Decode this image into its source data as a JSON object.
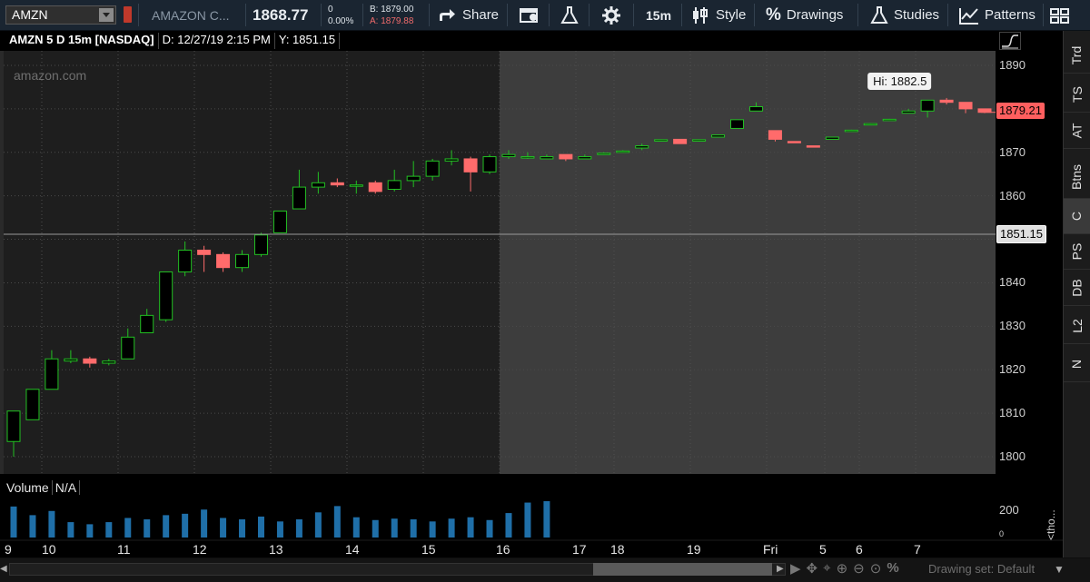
{
  "toolbar": {
    "symbol": "AMZN",
    "company": "AMAZON C...",
    "last_price": "1868.77",
    "change": "0",
    "change_pct": "0.00%",
    "bid": "B: 1879.00",
    "ask": "A: 1879.88",
    "share_label": "Share",
    "period_label": "15m",
    "style_label": "Style",
    "drawings_label": "Drawings",
    "studies_label": "Studies",
    "patterns_label": "Patterns"
  },
  "chart_header": {
    "title": "AMZN 5 D 15m [NASDAQ]",
    "date": "D: 12/27/19 2:15 PM",
    "y": "Y: 1851.15"
  },
  "watermark": "amazon.com",
  "price_axis": {
    "ticks": [
      "1890",
      "1880",
      "1870",
      "1860",
      "1850",
      "1840",
      "1830",
      "1820",
      "1810",
      "1800"
    ],
    "last_tag": "1879.21",
    "cursor_tag": "1851.15",
    "hi_label": "Hi: 1882.5"
  },
  "volume": {
    "label": "Volume",
    "value": "N/A",
    "axis_tick": "200",
    "axis_zero": "0",
    "axis_side": "<tho..."
  },
  "time_axis": [
    "9",
    "10",
    "11",
    "12",
    "13",
    "14",
    "15",
    "16",
    "17",
    "18",
    "19",
    "Fri",
    "5",
    "6",
    "7"
  ],
  "right_nav": [
    "Trd",
    "TS",
    "AT",
    "Btns",
    "C",
    "PS",
    "DB",
    "L2",
    "N"
  ],
  "bottom": {
    "drawing_set": "Drawing set: Default"
  },
  "colors": {
    "up": "#19b519",
    "down": "#ff6b6b",
    "toolbar": "#1a2531",
    "accent": "#e14c4c"
  },
  "chart_data": {
    "type": "candlestick",
    "title": "AMZN 5 D 15m [NASDAQ]",
    "ylim": [
      1797,
      1894
    ],
    "candles": [
      {
        "o": 1803.5,
        "h": 1810.5,
        "l": 1800.0,
        "c": 1810.5,
        "x": "9"
      },
      {
        "o": 1808.5,
        "h": 1815.5,
        "l": 1808.5,
        "c": 1815.5,
        "x": ""
      },
      {
        "o": 1815.5,
        "h": 1824.5,
        "l": 1815.5,
        "c": 1822.5,
        "x": "10"
      },
      {
        "o": 1822.0,
        "h": 1824.5,
        "l": 1821.5,
        "c": 1822.5,
        "x": ""
      },
      {
        "o": 1822.5,
        "h": 1823.0,
        "l": 1820.5,
        "c": 1821.5,
        "x": ""
      },
      {
        "o": 1821.5,
        "h": 1822.5,
        "l": 1821.0,
        "c": 1822.0,
        "x": ""
      },
      {
        "o": 1822.5,
        "h": 1829.5,
        "l": 1822.5,
        "c": 1827.5,
        "x": "11"
      },
      {
        "o": 1828.5,
        "h": 1834.0,
        "l": 1828.5,
        "c": 1832.5,
        "x": ""
      },
      {
        "o": 1831.5,
        "h": 1842.5,
        "l": 1831.0,
        "c": 1842.5,
        "x": ""
      },
      {
        "o": 1842.5,
        "h": 1849.5,
        "l": 1841.5,
        "c": 1847.5,
        "x": ""
      },
      {
        "o": 1847.5,
        "h": 1848.5,
        "l": 1842.5,
        "c": 1846.5,
        "x": "12"
      },
      {
        "o": 1846.5,
        "h": 1847.0,
        "l": 1842.5,
        "c": 1843.5,
        "x": ""
      },
      {
        "o": 1843.5,
        "h": 1847.5,
        "l": 1842.5,
        "c": 1846.5,
        "x": ""
      },
      {
        "o": 1846.5,
        "h": 1851.5,
        "l": 1846.0,
        "c": 1851.0,
        "x": "13"
      },
      {
        "o": 1851.5,
        "h": 1856.5,
        "l": 1851.5,
        "c": 1856.5,
        "x": ""
      },
      {
        "o": 1857.0,
        "h": 1866.0,
        "l": 1857.0,
        "c": 1862.0,
        "x": ""
      },
      {
        "o": 1862.0,
        "h": 1865.5,
        "l": 1860.5,
        "c": 1863.0,
        "x": ""
      },
      {
        "o": 1863.0,
        "h": 1864.0,
        "l": 1862.0,
        "c": 1862.5,
        "x": "14"
      },
      {
        "o": 1862.5,
        "h": 1863.5,
        "l": 1860.5,
        "c": 1862.5,
        "x": ""
      },
      {
        "o": 1863.0,
        "h": 1863.5,
        "l": 1860.5,
        "c": 1861.0,
        "x": ""
      },
      {
        "o": 1861.5,
        "h": 1866.0,
        "l": 1861.0,
        "c": 1863.5,
        "x": ""
      },
      {
        "o": 1863.5,
        "h": 1868.0,
        "l": 1862.0,
        "c": 1864.5,
        "x": ""
      },
      {
        "o": 1864.5,
        "h": 1868.5,
        "l": 1863.5,
        "c": 1868.0,
        "x": "15"
      },
      {
        "o": 1868.0,
        "h": 1870.5,
        "l": 1867.0,
        "c": 1868.5,
        "x": ""
      },
      {
        "o": 1868.5,
        "h": 1869.0,
        "l": 1861.0,
        "c": 1865.5,
        "x": ""
      },
      {
        "o": 1865.5,
        "h": 1869.5,
        "l": 1865.0,
        "c": 1869.0,
        "x": ""
      },
      {
        "o": 1869.0,
        "h": 1870.5,
        "l": 1868.5,
        "c": 1869.5,
        "x": "16"
      },
      {
        "o": 1869.0,
        "h": 1870.0,
        "l": 1868.5,
        "c": 1869.0,
        "x": ""
      },
      {
        "o": 1868.5,
        "h": 1869.5,
        "l": 1868.5,
        "c": 1869.0,
        "x": ""
      },
      {
        "o": 1869.5,
        "h": 1869.5,
        "l": 1868.0,
        "c": 1868.5,
        "x": "17"
      },
      {
        "o": 1868.5,
        "h": 1869.5,
        "l": 1868.5,
        "c": 1869.0,
        "x": ""
      },
      {
        "o": 1869.5,
        "h": 1870.0,
        "l": 1869.5,
        "c": 1869.8,
        "x": "18"
      },
      {
        "o": 1870.0,
        "h": 1870.5,
        "l": 1870.0,
        "c": 1870.3,
        "x": ""
      },
      {
        "o": 1871.0,
        "h": 1872.0,
        "l": 1870.5,
        "c": 1871.5,
        "x": ""
      },
      {
        "o": 1872.8,
        "h": 1873.0,
        "l": 1872.5,
        "c": 1872.9,
        "x": ""
      },
      {
        "o": 1873.0,
        "h": 1873.0,
        "l": 1872.0,
        "c": 1872.0,
        "x": "19"
      },
      {
        "o": 1872.8,
        "h": 1872.8,
        "l": 1872.5,
        "c": 1872.9,
        "x": ""
      },
      {
        "o": 1873.5,
        "h": 1874.0,
        "l": 1873.5,
        "c": 1874.0,
        "x": ""
      },
      {
        "o": 1875.5,
        "h": 1877.5,
        "l": 1875.5,
        "c": 1877.5,
        "x": ""
      },
      {
        "o": 1879.5,
        "h": 1881.5,
        "l": 1879.5,
        "c": 1880.5,
        "x": ""
      },
      {
        "o": 1875.0,
        "h": 1875.0,
        "l": 1872.5,
        "c": 1873.0,
        "x": "Fri"
      },
      {
        "o": 1872.5,
        "h": 1872.5,
        "l": 1872.3,
        "c": 1872.4,
        "x": ""
      },
      {
        "o": 1871.5,
        "h": 1871.5,
        "l": 1871.3,
        "c": 1871.4,
        "x": ""
      },
      {
        "o": 1873.0,
        "h": 1873.5,
        "l": 1873.0,
        "c": 1873.5,
        "x": "5"
      },
      {
        "o": 1875.0,
        "h": 1875.2,
        "l": 1874.8,
        "c": 1875.1,
        "x": ""
      },
      {
        "o": 1876.5,
        "h": 1876.7,
        "l": 1876.3,
        "c": 1876.6,
        "x": "6"
      },
      {
        "o": 1877.5,
        "h": 1877.7,
        "l": 1877.3,
        "c": 1877.6,
        "x": ""
      },
      {
        "o": 1879.0,
        "h": 1880.0,
        "l": 1879.0,
        "c": 1879.5,
        "x": ""
      },
      {
        "o": 1879.5,
        "h": 1882.0,
        "l": 1878.0,
        "c": 1882.0,
        "x": "7"
      },
      {
        "o": 1882.0,
        "h": 1882.5,
        "l": 1881.0,
        "c": 1881.5,
        "x": ""
      },
      {
        "o": 1881.5,
        "h": 1881.5,
        "l": 1879.0,
        "c": 1880.0,
        "x": ""
      },
      {
        "o": 1880.0,
        "h": 1880.0,
        "l": 1879.0,
        "c": 1879.2,
        "x": ""
      }
    ],
    "volume": [
      222,
      160,
      190,
      110,
      95,
      110,
      140,
      130,
      160,
      170,
      200,
      140,
      130,
      150,
      115,
      130,
      180,
      225,
      145,
      125,
      135,
      130,
      115,
      135,
      145,
      125,
      175,
      250,
      260
    ]
  }
}
